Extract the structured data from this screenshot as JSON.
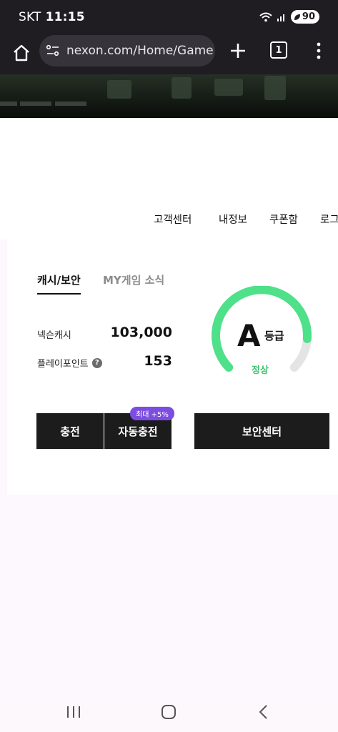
{
  "status_bar": {
    "carrier": "SKT",
    "time": "11:15",
    "battery": "90"
  },
  "browser": {
    "url": "nexon.com/Home/Game",
    "tab_count": "1"
  },
  "top_nav": {
    "items": [
      "고객센터",
      "내정보",
      "쿠폰함",
      "로그"
    ]
  },
  "card": {
    "tabs": [
      "캐시/보안",
      "MY게임 소식"
    ],
    "nexon_cash_label": "넥슨캐시",
    "nexon_cash_value": "103,000",
    "play_point_label": "플레이포인트",
    "play_point_value": "153",
    "help_icon": "?",
    "charge_button": "충전",
    "auto_charge_button": "자동충전",
    "promo_badge": "최대 +5%",
    "security_center_button": "보안센터",
    "security_grade": "A",
    "security_grade_suffix": "등급",
    "security_status": "정상",
    "security_gauge_level": 0.85
  },
  "colors": {
    "gauge": "#4fe08a",
    "badge": "#7b4de0",
    "button": "#1c1c1c"
  }
}
